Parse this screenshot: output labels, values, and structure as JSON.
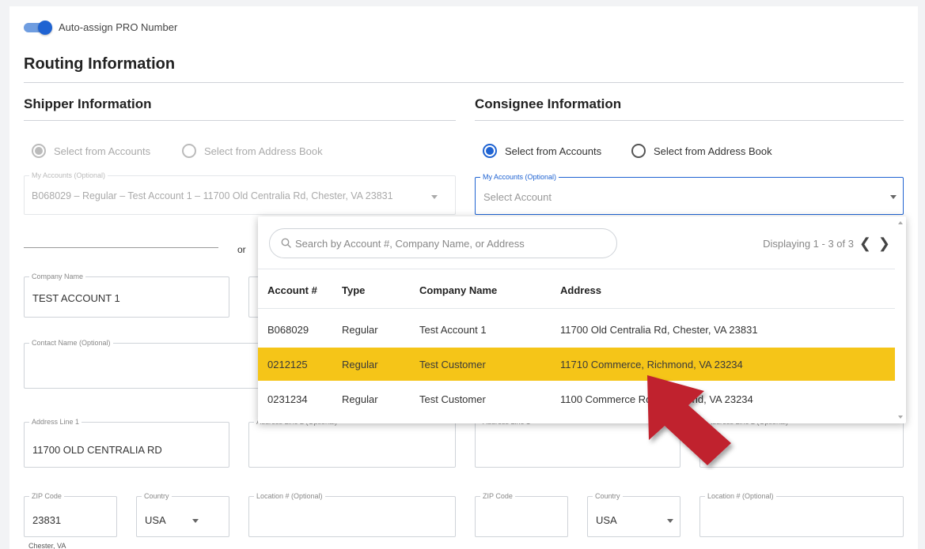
{
  "toggle": {
    "label": "Auto-assign PRO Number",
    "on": true
  },
  "routing": {
    "title": "Routing Information"
  },
  "shipper": {
    "title": "Shipper Information",
    "radio_accounts": "Select from Accounts",
    "radio_book": "Select from Address Book",
    "my_accounts_label": "My Accounts (Optional)",
    "my_accounts_value": "B068029 – Regular – Test Account 1 – 11700 Old Centralia Rd, Chester, VA 23831",
    "or_text": "or",
    "company_label": "Company Name",
    "company_value": "TEST ACCOUNT 1",
    "contact_label": "Contact Name (Optional)",
    "address1_label": "Address Line 1",
    "address1_value": "11700 OLD CENTRALIA RD",
    "address2_label": "Address Line 2 (Optional)",
    "zip_label": "ZIP Code",
    "zip_value": "23831",
    "country_label": "Country",
    "country_value": "USA",
    "location_label": "Location # (Optional)",
    "city_state": "Chester, VA"
  },
  "consignee": {
    "title": "Consignee Information",
    "radio_accounts": "Select from Accounts",
    "radio_book": "Select from Address Book",
    "my_accounts_label": "My Accounts (Optional)",
    "my_accounts_placeholder": "Select Account",
    "address1_label": "Address Line 1",
    "address2_label": "Address Line 2 (Optional)",
    "zip_label": "ZIP Code",
    "country_label": "Country",
    "country_value": "USA",
    "location_label": "Location # (Optional)"
  },
  "dropdown": {
    "search_placeholder": "Search by Account #, Company Name, or Address",
    "display_text": "Displaying 1 - 3 of 3",
    "columns": [
      "Account #",
      "Type",
      "Company Name",
      "Address"
    ],
    "rows": [
      {
        "account": "B068029",
        "type": "Regular",
        "company": "Test Account 1",
        "address": "11700 Old Centralia Rd, Chester, VA 23831"
      },
      {
        "account": "0212125",
        "type": "Regular",
        "company": "Test Customer",
        "address": "11710 Commerce, Richmond, VA 23234"
      },
      {
        "account": "0231234",
        "type": "Regular",
        "company": "Test Customer",
        "address": "1100 Commerce Rd, Richmond, VA 23234"
      }
    ],
    "selected_row": 1
  },
  "colors": {
    "accent": "#1f63d2",
    "highlight": "#f5c518",
    "arrow": "#c0202f"
  }
}
